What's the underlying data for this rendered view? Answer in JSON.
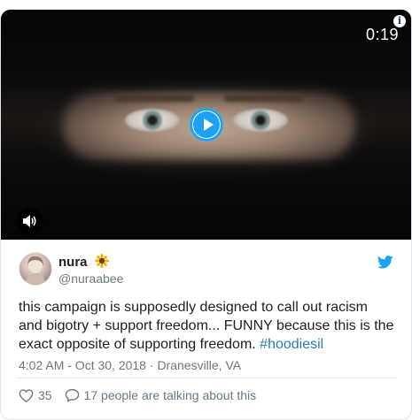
{
  "video": {
    "duration": "0:19",
    "info_glyph": "i",
    "state": "paused"
  },
  "author": {
    "name": "nura",
    "handle": "@nuraabee",
    "emoji": "sunflower-icon"
  },
  "tweet": {
    "text_main": "this campaign is supposedly designed to call out racism and bigotry + support freedom... FUNNY because this is the exact opposite of supporting freedom. ",
    "hashtag": "#hoodiesil",
    "timestamp": "4:02 AM - Oct 30, 2018",
    "separator": " · ",
    "location": "Dranesville, VA"
  },
  "actions": {
    "like_count": "35",
    "conversation_text": "17 people are talking about this"
  },
  "colors": {
    "accent": "#1da1f2",
    "link": "#2b7bb9",
    "text": "#1c2022",
    "muted": "#697882",
    "border": "#e1e8ed"
  }
}
